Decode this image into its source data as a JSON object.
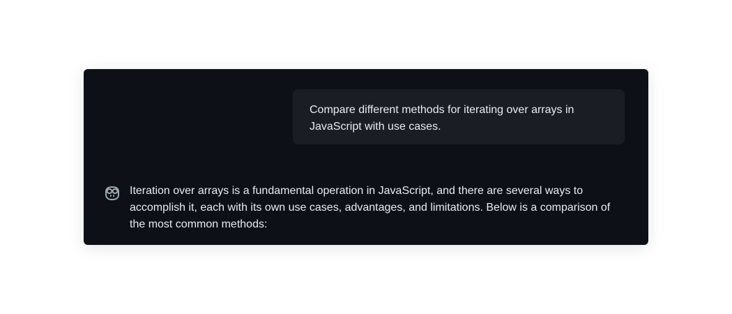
{
  "conversation": {
    "user_message": "Compare different methods for iterating over arrays in JavaScript with use cases.",
    "assistant_avatar_icon": "copilot-icon",
    "assistant_message": "Iteration over arrays is a fundamental operation in JavaScript, and there are several ways to accomplish it, each with its own use cases, advantages, and limitations. Below is a comparison of the most common methods:"
  },
  "colors": {
    "panel_background": "#0d1117",
    "user_bubble_background": "#1a1e24",
    "text": "#e6edf3",
    "icon": "#9ea7b3"
  }
}
